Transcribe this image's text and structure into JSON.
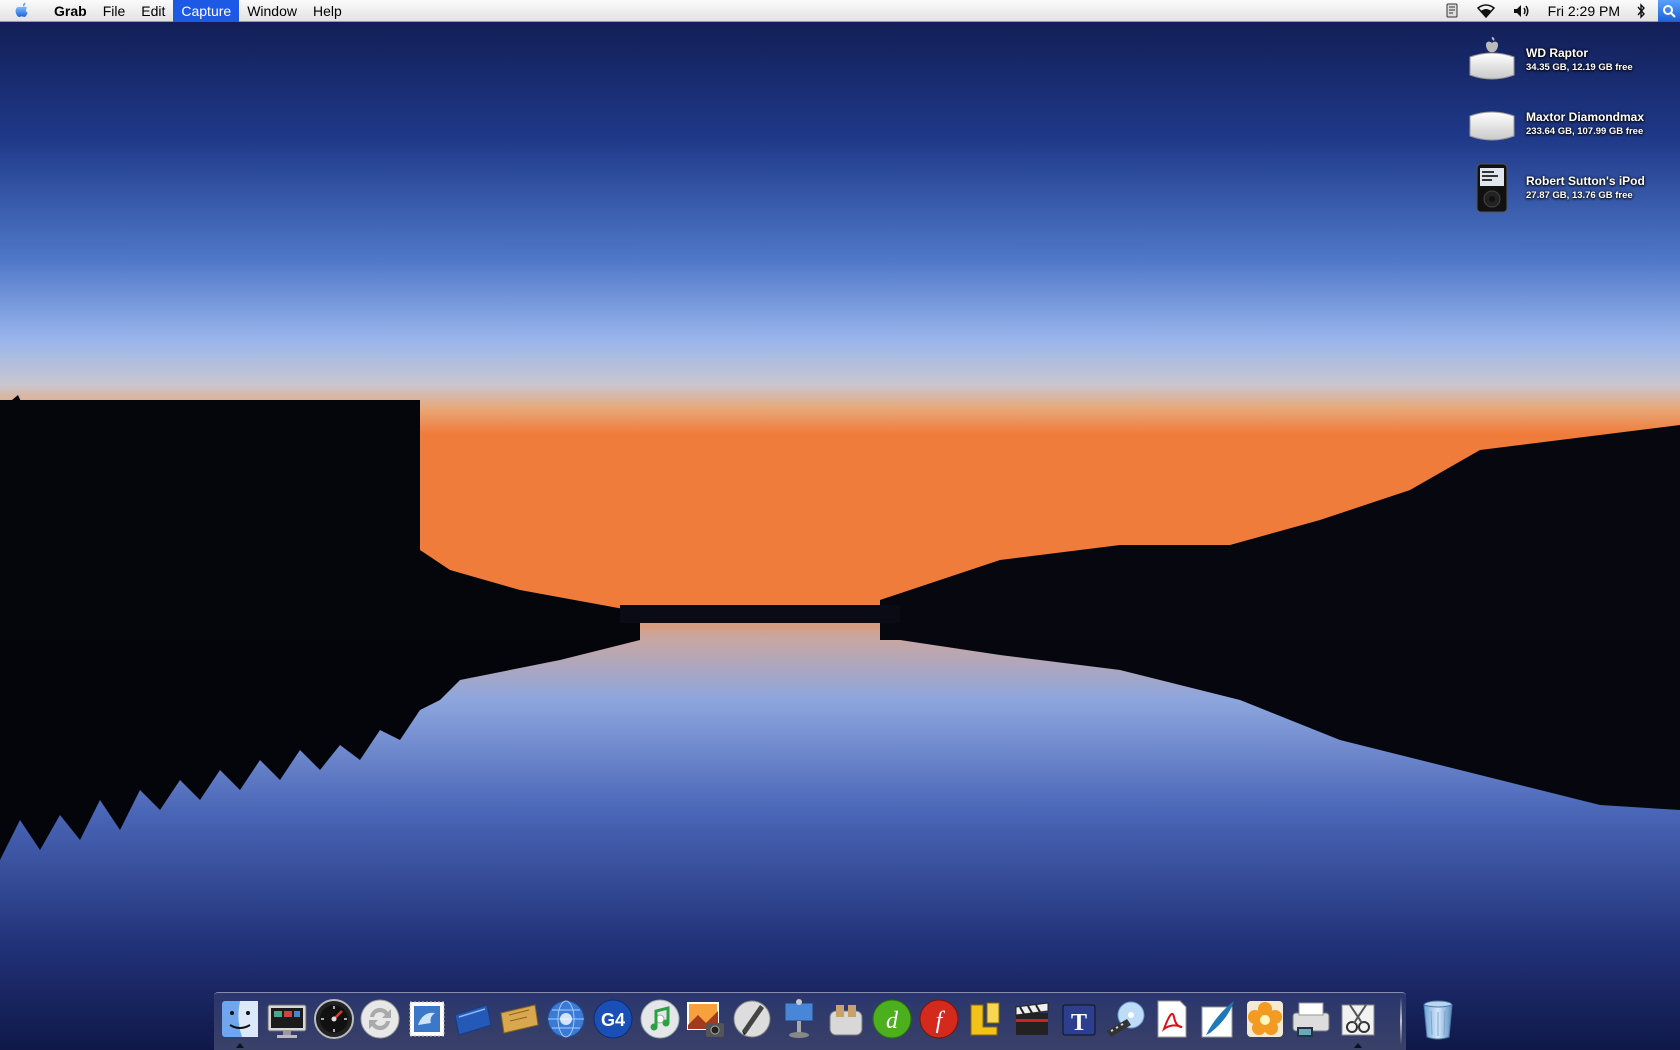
{
  "menubar": {
    "app_name": "Grab",
    "items": [
      "File",
      "Edit",
      "Capture",
      "Window",
      "Help"
    ],
    "selected_item": "Capture",
    "clock": "Fri 2:29 PM",
    "status_icons": [
      "script-menu-icon",
      "airport-wifi-icon",
      "volume-icon",
      "clock",
      "bluetooth-icon",
      "spotlight-icon"
    ]
  },
  "desktop": {
    "volumes": [
      {
        "name": "WD Raptor",
        "info": "34.35 GB, 12.19 GB free",
        "icon": "external-drive-apple-icon"
      },
      {
        "name": "Maxtor Diamondmax",
        "info": "233.64 GB, 107.99 GB free",
        "icon": "external-drive-icon"
      },
      {
        "name": "Robert Sutton's iPod",
        "info": "27.87 GB, 13.76 GB free",
        "icon": "ipod-icon"
      }
    ]
  },
  "dock": {
    "items": [
      {
        "name": "finder",
        "icon": "finder-icon",
        "running": true
      },
      {
        "name": "system-profiler",
        "icon": "monitor-icon",
        "running": false
      },
      {
        "name": "dashboard",
        "icon": "dashboard-icon",
        "running": false
      },
      {
        "name": "isync",
        "icon": "sync-icon",
        "running": false
      },
      {
        "name": "mail",
        "icon": "mail-stamp-icon",
        "running": false
      },
      {
        "name": "notebook",
        "icon": "blue-notebook-icon",
        "running": false
      },
      {
        "name": "ticket",
        "icon": "ticket-icon",
        "running": false
      },
      {
        "name": "safari",
        "icon": "globe-icon",
        "running": false
      },
      {
        "name": "g4",
        "icon": "g4-globe-icon",
        "running": false
      },
      {
        "name": "itunes",
        "icon": "itunes-icon",
        "running": false
      },
      {
        "name": "iphoto",
        "icon": "iphoto-icon",
        "running": false
      },
      {
        "name": "script-editor",
        "icon": "pen-icon",
        "running": false
      },
      {
        "name": "keynote",
        "icon": "keynote-icon",
        "running": false
      },
      {
        "name": "toast",
        "icon": "toaster-icon",
        "running": false
      },
      {
        "name": "dreamweaver",
        "icon": "dreamweaver-icon",
        "running": false
      },
      {
        "name": "flash",
        "icon": "flash-icon",
        "running": false
      },
      {
        "name": "office",
        "icon": "office-icon",
        "running": false
      },
      {
        "name": "imovie",
        "icon": "clapboard-icon",
        "running": false
      },
      {
        "name": "text-tool",
        "icon": "text-t-icon",
        "running": false
      },
      {
        "name": "dvd-app",
        "icon": "film-disc-icon",
        "running": false
      },
      {
        "name": "acrobat",
        "icon": "acrobat-icon",
        "running": false
      },
      {
        "name": "ink-app",
        "icon": "feather-icon",
        "running": false
      },
      {
        "name": "photoshop-elements",
        "icon": "flower-icon",
        "running": false
      },
      {
        "name": "printer",
        "icon": "printer-icon",
        "running": false
      },
      {
        "name": "grab",
        "icon": "grab-icon",
        "running": true
      }
    ],
    "trash": {
      "name": "trash",
      "icon": "trash-icon"
    }
  }
}
